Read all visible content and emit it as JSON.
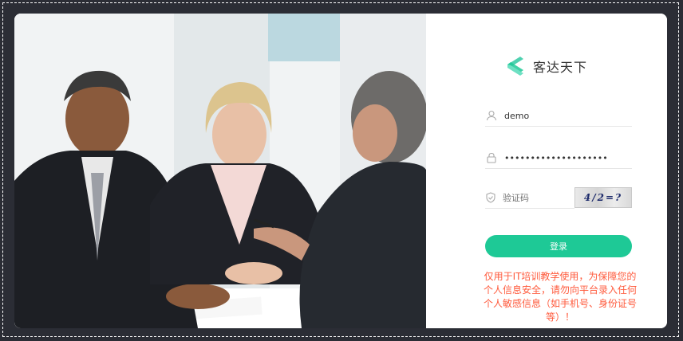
{
  "brand": {
    "name": "客达天下",
    "primary_color": "#1ec996",
    "logo_icon": "chevron-logo-icon"
  },
  "login": {
    "username_value": "demo",
    "username_icon": "user-icon",
    "password_value": "••••••••••••••••••••",
    "password_icon": "lock-icon",
    "captcha_placeholder": "验证码",
    "captcha_icon": "shield-icon",
    "captcha_image_text": "4/2=?",
    "submit_label": "登录"
  },
  "notice": {
    "text": "仅用于IT培训教学使用，为保障您的个人信息安全，请勿向平台录入任何个人敏感信息（如手机号、身份证号等）！",
    "color": "#ff5a3c"
  },
  "colors": {
    "frame_bg": "#2b2d35",
    "panel_bg": "#ffffff"
  }
}
